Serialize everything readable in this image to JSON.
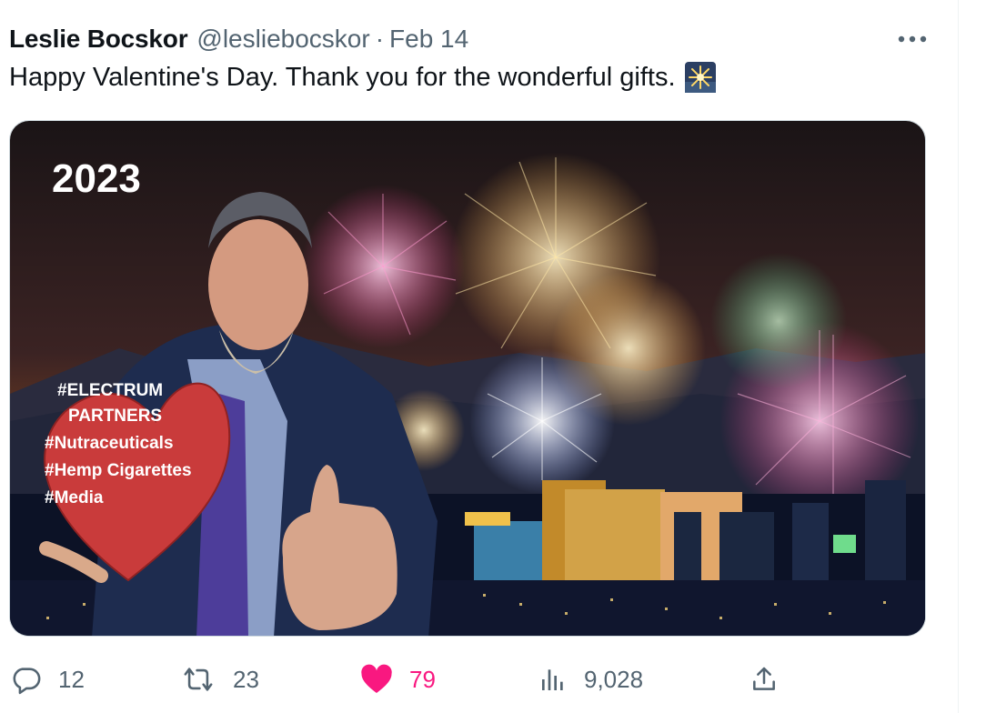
{
  "tweet": {
    "author_name": "Leslie Bocskor",
    "handle": "@lesliebocskor",
    "separator": "·",
    "date": "Feb 14",
    "text": "Happy Valentine's Day. Thank you for the wonderful gifts.",
    "more_glyph": "•••"
  },
  "media": {
    "year": "2023",
    "heart_lines": [
      "#ELECTRUM",
      "PARTNERS",
      "#Nutraceuticals",
      "#Hemp Cigarettes",
      "#Media"
    ]
  },
  "actions": {
    "replies": "12",
    "reposts": "23",
    "likes": "79",
    "views": "9,028"
  },
  "colors": {
    "like_active": "#f91880",
    "secondary_text": "#536471",
    "primary_text": "#0f1419"
  },
  "icons": [
    "reply-icon",
    "repost-icon",
    "heart-icon",
    "views-icon",
    "share-icon",
    "more-icon",
    "sparkle-emoji"
  ]
}
